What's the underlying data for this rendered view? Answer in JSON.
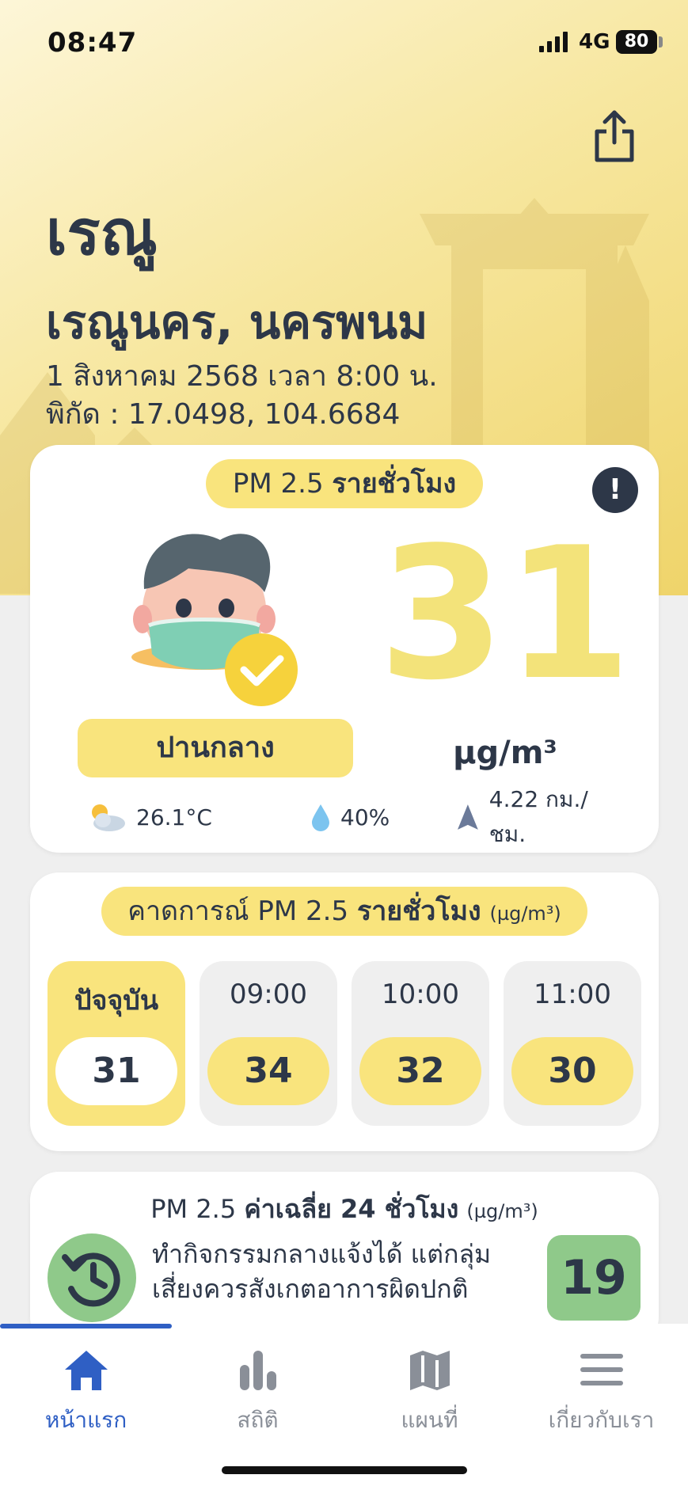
{
  "status_bar": {
    "time": "08:47",
    "network": "4G",
    "battery": "80"
  },
  "header": {
    "title": "เรณู",
    "location": "เรณูนคร, นครพนม",
    "date_time": "1 สิงหาคม 2568  เวลา 8:00 น.",
    "coordinates": "พิกัด : 17.0498, 104.6684"
  },
  "current": {
    "title_prefix": "PM 2.5 ",
    "title_bold": "รายชั่วโมง",
    "info_label": "!",
    "level_label": "ปานกลาง",
    "value": "31",
    "unit": "µg/m³",
    "temperature": "26.1°C",
    "humidity": "40%",
    "wind": "4.22 กม./ชม."
  },
  "forecast": {
    "title_prefix": "คาดการณ์ PM 2.5 ",
    "title_bold": "รายชั่วโมง",
    "title_unit": "(µg/m³)",
    "slots": [
      {
        "label": "ปัจจุบัน",
        "value": "31"
      },
      {
        "label": "09:00",
        "value": "34"
      },
      {
        "label": "10:00",
        "value": "32"
      },
      {
        "label": "11:00",
        "value": "30"
      }
    ]
  },
  "average": {
    "title_prefix": "PM 2.5 ",
    "title_bold": "ค่าเฉลี่ย 24 ชั่วโมง",
    "title_unit": "(µg/m³)",
    "advice_line1": "ทำกิจกรรมกลางแจ้งได้ แต่กลุ่ม",
    "advice_line2": "เสี่ยงควรสังเกตอาการผิดปกติ",
    "value": "19"
  },
  "tabs": [
    {
      "label": "หน้าแรก",
      "icon": "home-icon",
      "active": true
    },
    {
      "label": "สถิติ",
      "icon": "bar-chart-icon",
      "active": false
    },
    {
      "label": "แผนที่",
      "icon": "map-icon",
      "active": false
    },
    {
      "label": "เกี่ยวกับเรา",
      "icon": "menu-icon",
      "active": false
    }
  ],
  "colors": {
    "accent_yellow": "#f9e47d",
    "value_yellow": "#f3e37a",
    "good_green": "#8fc98a",
    "active_blue": "#2f5fc4",
    "text_dark": "#2d3748"
  }
}
